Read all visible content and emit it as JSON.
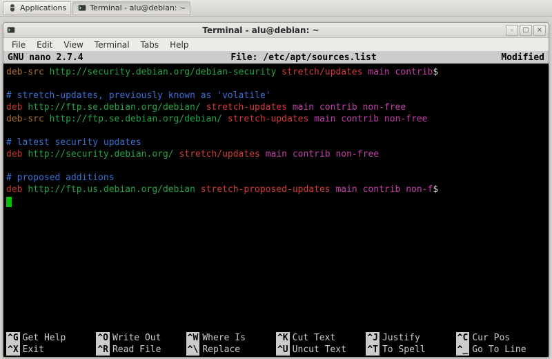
{
  "taskbar": {
    "apps_label": "Applications",
    "task_label": "Terminal - alu@debian: ~"
  },
  "window": {
    "title": "Terminal - alu@debian: ~",
    "menus": [
      "File",
      "Edit",
      "View",
      "Terminal",
      "Tabs",
      "Help"
    ]
  },
  "nano": {
    "title_left": "GNU nano 2.7.4",
    "title_mid": "File: /etc/apt/sources.list",
    "title_right": "Modified",
    "keys_row1": [
      {
        "k": "^G",
        "lbl": "Get Help"
      },
      {
        "k": "^O",
        "lbl": "Write Out"
      },
      {
        "k": "^W",
        "lbl": "Where Is"
      },
      {
        "k": "^K",
        "lbl": "Cut Text"
      },
      {
        "k": "^J",
        "lbl": "Justify"
      },
      {
        "k": "^C",
        "lbl": "Cur Pos"
      }
    ],
    "keys_row2": [
      {
        "k": "^X",
        "lbl": "Exit"
      },
      {
        "k": "^R",
        "lbl": "Read File"
      },
      {
        "k": "^\\",
        "lbl": "Replace"
      },
      {
        "k": "^U",
        "lbl": "Uncut Text"
      },
      {
        "k": "^T",
        "lbl": "To Spell"
      },
      {
        "k": "^_",
        "lbl": "Go To Line"
      }
    ]
  },
  "file": {
    "lines": [
      {
        "t": "entry",
        "src": true,
        "url": "http://security.debian.org/debian-security",
        "suite": "stretch/updates",
        "comps": "main contrib",
        "trunc": true
      },
      {
        "t": "blank"
      },
      {
        "t": "comment",
        "text": "# stretch-updates, previously known as 'volatile'"
      },
      {
        "t": "entry",
        "src": false,
        "url": "http://ftp.se.debian.org/debian/",
        "suite": "stretch-updates",
        "comps": "main contrib non-free"
      },
      {
        "t": "entry",
        "src": true,
        "url": "http://ftp.se.debian.org/debian/",
        "suite": "stretch-updates",
        "comps": "main contrib non-free"
      },
      {
        "t": "blank"
      },
      {
        "t": "comment",
        "text": "# latest security updates"
      },
      {
        "t": "entry",
        "src": false,
        "url": "http://security.debian.org/",
        "suite": "stretch/updates",
        "comps": "main contrib non-free"
      },
      {
        "t": "blank"
      },
      {
        "t": "comment",
        "text": "# proposed additions"
      },
      {
        "t": "entry",
        "src": false,
        "url": "http://ftp.us.debian.org/debian",
        "suite": "stretch-proposed-updates",
        "comps": "main contrib non-f",
        "trunc": true
      }
    ]
  }
}
